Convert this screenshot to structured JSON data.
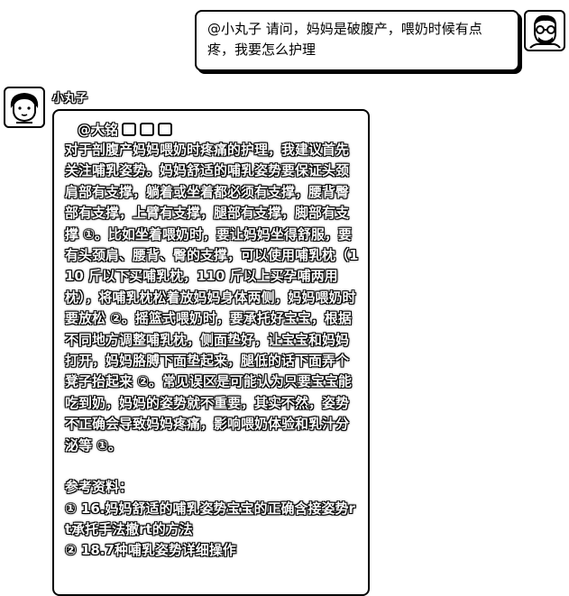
{
  "user_message": {
    "text": "@小丸子  请问，妈妈是破腹产，喂奶时候有点疼，我要怎么护理"
  },
  "bot": {
    "name": "小丸子",
    "mention": "@大铭",
    "answer": "对于剖腹产妈妈喂奶时疼痛的护理，我建议首先关注哺乳姿势。妈妈舒适的哺乳姿势要保证头颈肩部有支撑，躺着或坐着都必须有支撑，腰背臀部有支撑，上臂有支撑，腿部有支撑，脚部有支撑 ①。比如坐着喂奶时，要让妈妈坐得舒服，要有头颈肩、腰背、臀的支撑，可以使用哺乳枕（110 斤以下买哺乳枕，110 斤以上买孕哺两用枕），将哺乳枕松着放妈妈身体两侧，妈妈喂奶时要放松 ②。摇篮式喂奶时，要承托好宝宝，根据不同地方调整哺乳枕，侧面垫好，让宝宝和妈妈打开，妈妈胳膊下面垫起来，腿低的话下面弄个凳子抬起来 ②。常见误区是可能认为只要宝宝能吃到奶，妈妈的姿势就不重要，其实不然，姿势不正确会导致妈妈疼痛，影响喂奶体验和乳汁分泌等 ①。",
    "refs_title": "参考资料：",
    "refs": [
      "① 16.妈妈舒适的哺乳姿势宝宝的正确含接姿势rt承托手法撤rt的方法",
      "② 18.7种哺乳姿势详细操作"
    ]
  }
}
